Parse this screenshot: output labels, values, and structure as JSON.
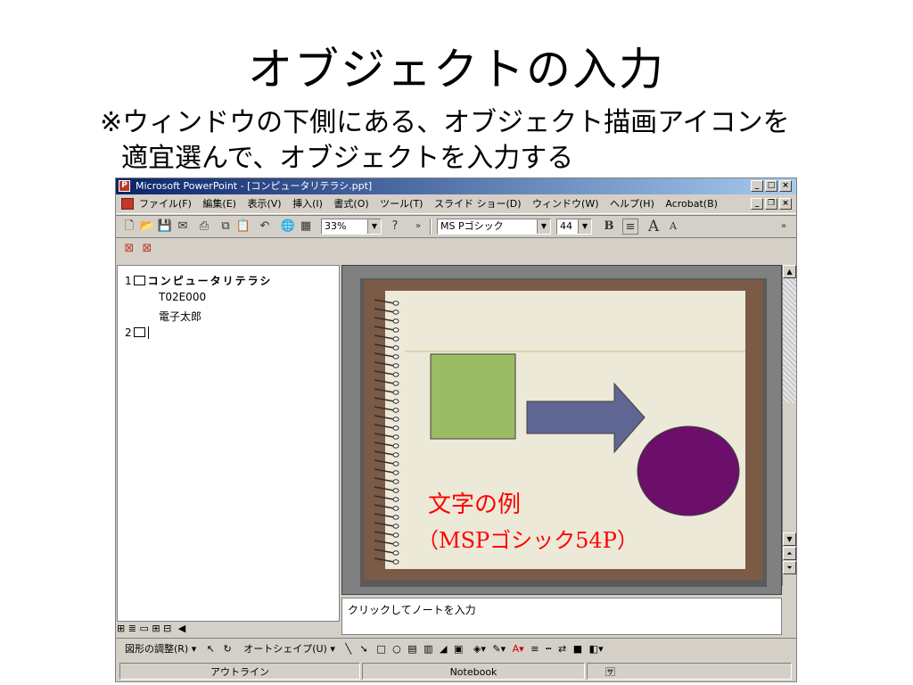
{
  "slide": {
    "title": "オブジェクトの入力",
    "note_line1": "※ウィンドウの下側にある、オブジェクト描画アイコンを",
    "note_line2": "適宜選んで、オブジェクトを入力する"
  },
  "window": {
    "title": "Microsoft PowerPoint - [コンピュータリテラシ.ppt]",
    "app_icon": "powerpoint-icon"
  },
  "menu": {
    "items": [
      "ファイル(F)",
      "編集(E)",
      "表示(V)",
      "挿入(I)",
      "書式(O)",
      "ツール(T)",
      "スライド ショー(D)",
      "ウィンドウ(W)",
      "ヘルプ(H)",
      "Acrobat(B)"
    ]
  },
  "toolbar": {
    "zoom": "33%",
    "font_name": "MS Pゴシック",
    "font_size": "44",
    "bold": "B",
    "font_grow": "A",
    "font_shrink": "A"
  },
  "outline": {
    "slide1_num": "1",
    "slide1_title": "コンピュータリテラシ",
    "slide1_line1": "T02E000",
    "slide1_line2": "電子太郎",
    "slide2_num": "2"
  },
  "slide_preview": {
    "text_line1": "文字の例",
    "text_line2": "（MSPゴシック54P）",
    "colors": {
      "frame": "#7b5a46",
      "paper": "#ece9d8",
      "square": "#9bbb65",
      "arrow": "#5f6694",
      "circle": "#6b0f6b",
      "text": "#ff0000"
    }
  },
  "notes": {
    "placeholder": "クリックしてノートを入力"
  },
  "drawbar": {
    "draw_menu": "図形の調整(R)",
    "autoshapes": "オートシェイプ(U)"
  },
  "status": {
    "view": "アウトライン",
    "design": "Notebook"
  }
}
